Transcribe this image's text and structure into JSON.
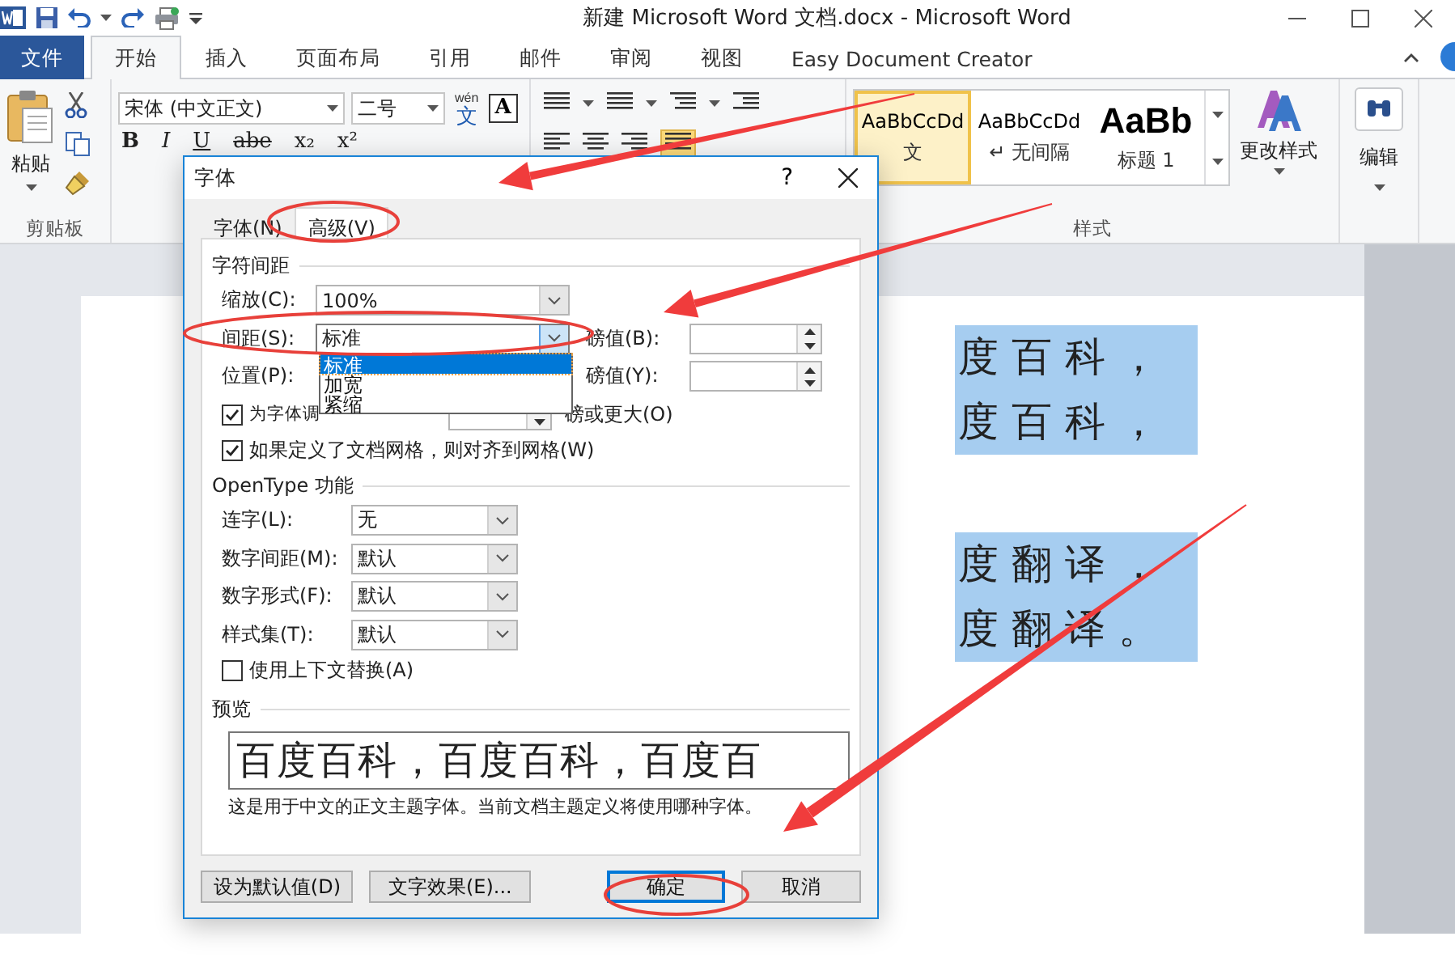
{
  "window": {
    "title": "新建 Microsoft Word 文档.docx  -  Microsoft Word"
  },
  "ribbon_tabs": [
    {
      "label": "文件",
      "kind": "file",
      "selected": false
    },
    {
      "label": "开始",
      "kind": "tab",
      "selected": true
    },
    {
      "label": "插入",
      "kind": "tab",
      "selected": false
    },
    {
      "label": "页面布局",
      "kind": "tab",
      "selected": false
    },
    {
      "label": "引用",
      "kind": "tab",
      "selected": false
    },
    {
      "label": "邮件",
      "kind": "tab",
      "selected": false
    },
    {
      "label": "审阅",
      "kind": "tab",
      "selected": false
    },
    {
      "label": "视图",
      "kind": "tab",
      "selected": false
    },
    {
      "label": "Easy Document Creator",
      "kind": "tab",
      "selected": false
    }
  ],
  "clipboard": {
    "paste": "粘贴",
    "group_label": "剪贴板"
  },
  "font_group": {
    "font_name": "宋体 (中文正文)",
    "font_size": "二号",
    "pinyin": "wén",
    "pinyin_char": "文",
    "border_char": "A",
    "format_buttons": [
      "B",
      "I",
      "U",
      "abe",
      "x₂",
      "x²"
    ]
  },
  "styles": {
    "items": [
      {
        "sample": "AaBbCcDd",
        "name": "文",
        "kind": "normal",
        "selected": true
      },
      {
        "sample": "AaBbCcDd",
        "name": "↵ 无间隔",
        "kind": "normal",
        "selected": false
      },
      {
        "sample": "AaBb",
        "name": "标题 1",
        "kind": "heading",
        "selected": false
      }
    ],
    "change_styles": "更改样式",
    "group_label": "样式"
  },
  "editing": {
    "label": "编辑"
  },
  "document": {
    "lines": [
      "度 百 科 ，",
      "度 百 科 ，",
      "度 翻 译 ，",
      "度 翻 译 。"
    ]
  },
  "dialog": {
    "title": "字体",
    "help": "?",
    "tabs": [
      {
        "label": "字体(N)",
        "selected": false
      },
      {
        "label": "高级(V)",
        "selected": true
      }
    ],
    "spacing_section": {
      "title": "字符间距",
      "scale_label": "缩放(C):",
      "scale_value": "100%",
      "spacing_label": "间距(S):",
      "spacing_value": "标准",
      "spacing_by_label": "磅值(B):",
      "position_label": "位置(P):",
      "position_by_label": "磅值(Y):",
      "spacing_options": [
        {
          "label": "标准",
          "selected": true
        },
        {
          "label": "加宽",
          "selected": false
        },
        {
          "label": "紧缩",
          "selected": false
        }
      ],
      "kerning": {
        "label": "为字体调",
        "checked": true,
        "suffix": "磅或更大(O)"
      },
      "snap_to_grid": {
        "label": "如果定义了文档网格，则对齐到网格(W)",
        "checked": true
      }
    },
    "opentype_section": {
      "title": "OpenType 功能",
      "rows": [
        {
          "label": "连字(L):",
          "value": "无"
        },
        {
          "label": "数字间距(M):",
          "value": "默认"
        },
        {
          "label": "数字形式(F):",
          "value": "默认"
        },
        {
          "label": "样式集(T):",
          "value": "默认"
        }
      ],
      "contextual": {
        "label": "使用上下文替换(A)",
        "checked": false
      }
    },
    "preview_section": {
      "title": "预览",
      "sample": "百度百科，百度百科，百度百",
      "description": "这是用于中文的正文主题字体。当前文档主题定义将使用哪种字体。"
    },
    "buttons": [
      {
        "label": "设为默认值(D)",
        "kind": "normal"
      },
      {
        "label": "文字效果(E)...",
        "kind": "normal"
      },
      {
        "label": "确定",
        "kind": "default"
      },
      {
        "label": "取消",
        "kind": "normal"
      }
    ]
  }
}
